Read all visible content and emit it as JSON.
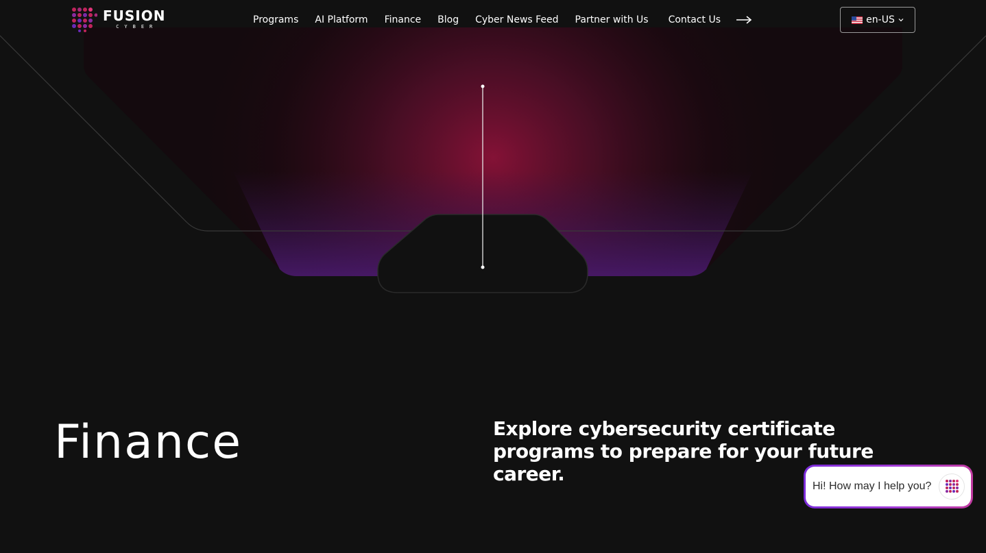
{
  "brand": {
    "name": "FUSION",
    "tagline": "CYBER"
  },
  "nav": {
    "items": [
      {
        "label": "Programs"
      },
      {
        "label": "AI Platform"
      },
      {
        "label": "Finance"
      },
      {
        "label": "Blog"
      },
      {
        "label": "Cyber News Feed"
      },
      {
        "label": "Partner with Us"
      },
      {
        "label": "Contact Us"
      }
    ],
    "arrow_icon": "arrow-right-icon"
  },
  "language": {
    "flag_icon": "us-flag-icon",
    "label": "en-US",
    "chevron_icon": "chevron-down-icon"
  },
  "hero": {
    "title": "Finance",
    "subtitle": "Explore cybersecurity certificate programs to prepare for your future career."
  },
  "chat": {
    "prompt": "Hi! How may I help you?",
    "avatar_icon": "fusion-logo-icon"
  },
  "colors": {
    "background": "#111111",
    "glow_magenta": "#8a1238",
    "glow_purple": "#4a1a6e",
    "chat_border_start": "#7b2cd9",
    "chat_border_end": "#c03aa0"
  }
}
